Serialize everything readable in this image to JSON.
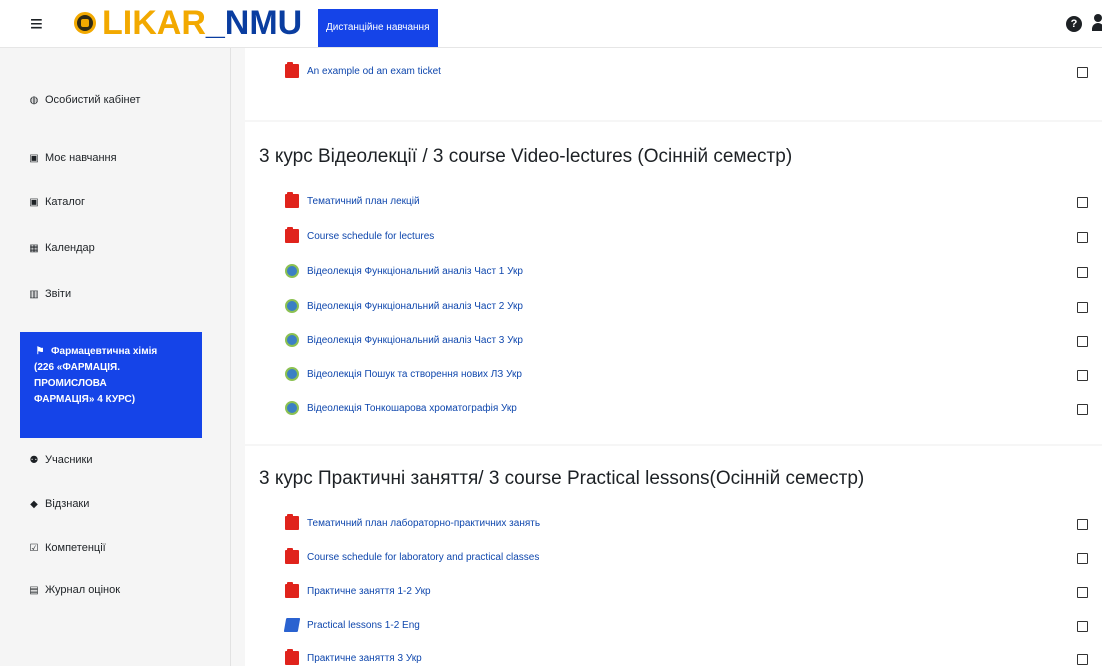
{
  "navbar": {
    "logo_part1": "LIKAR",
    "logo_part2": "_NMU",
    "nav_link": "Дистанційне навчання",
    "help_label": "?"
  },
  "sidebar": {
    "items": [
      {
        "icon": "tachometer-icon",
        "glyph": "◍",
        "label": "Особистий кабінет"
      },
      {
        "icon": "calendar-check-icon",
        "glyph": "▣",
        "label": "Моє навчання"
      },
      {
        "icon": "catalog-icon",
        "glyph": "▣",
        "label": "Каталог"
      },
      {
        "icon": "calendar-icon",
        "glyph": "▦",
        "label": "Календар"
      },
      {
        "icon": "chart-icon",
        "glyph": "▥",
        "label": "Звіти"
      }
    ],
    "active_course": {
      "icon": "graduation-cap-icon",
      "glyph": "⚑",
      "lines": [
        "Фармацевтична хімія",
        "(226 «ФАРМАЦІЯ.",
        "ПРОМИСЛОВА",
        "ФАРМАЦІЯ» 4 КУРС)"
      ]
    },
    "course_items": [
      {
        "icon": "users-icon",
        "glyph": "⚉",
        "label": "Учасники"
      },
      {
        "icon": "shield-icon",
        "glyph": "◆",
        "label": "Відзнаки"
      },
      {
        "icon": "check-square-icon",
        "glyph": "☑",
        "label": "Компетенції"
      },
      {
        "icon": "table-icon",
        "glyph": "▤",
        "label": "Журнал оцінок"
      }
    ]
  },
  "main": {
    "top_activity": {
      "type": "pdf",
      "label": "An example od an exam ticket"
    },
    "sections": [
      {
        "title": "3 курс Відеолекції / 3 course Video-lectures (Осінній семестр)",
        "activities": [
          {
            "type": "pdf",
            "label": "Тематичний план лекцій"
          },
          {
            "type": "pdf",
            "label": "Course schedule for lectures"
          },
          {
            "type": "url",
            "label": "Відеолекція Функціональний аналіз Част 1 Укр"
          },
          {
            "type": "url",
            "label": "Відеолекція Функціональний аналіз Част 2 Укр"
          },
          {
            "type": "url",
            "label": "Відеолекція Функціональний аналіз Част 3 Укр"
          },
          {
            "type": "url",
            "label": "Відеолекція Пошук та створення нових ЛЗ Укр"
          },
          {
            "type": "url",
            "label": "Відеолекція Тонкошарова хроматографія Укр"
          }
        ]
      },
      {
        "title": "3 курс Практичні заняття/ 3 course Practical lessons(Осінній семестр)",
        "activities": [
          {
            "type": "pdf",
            "label": "Тематичний план лабораторно-практичних занять"
          },
          {
            "type": "pdf",
            "label": "Course schedule for laboratory and practical classes"
          },
          {
            "type": "pdf",
            "label": "Практичне заняття 1-2 Укр"
          },
          {
            "type": "doc",
            "label": "Practical lessons 1-2 Eng"
          },
          {
            "type": "pdf",
            "label": "Практичне заняття 3 Укр"
          }
        ]
      }
    ]
  },
  "colors": {
    "brand_blue": "#1544e8",
    "logo_gold": "#f2a900",
    "logo_navy": "#0a3da0",
    "link_blue": "#0f47ad",
    "pdf_red": "#e0231c"
  }
}
